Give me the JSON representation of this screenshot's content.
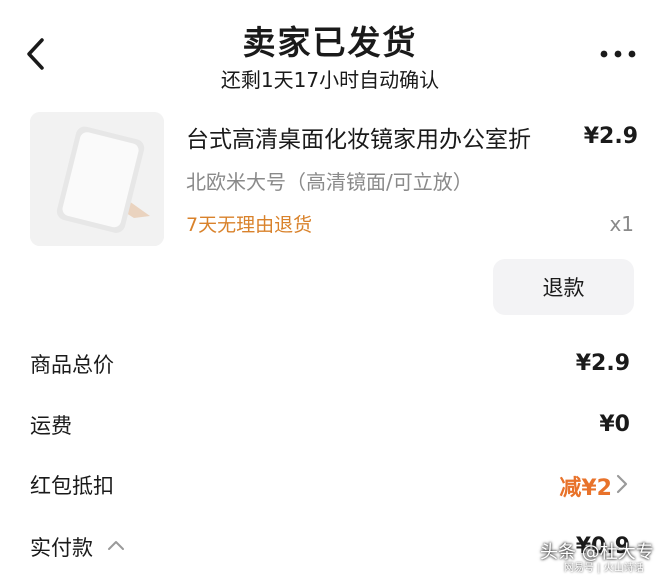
{
  "header": {
    "title": "卖家已发货",
    "subtitle": "还剩1天17小时自动确认"
  },
  "product": {
    "name": "台式高清桌面化妆镜家用办公室折",
    "price": "¥2.9",
    "variant": "北欧米大号（高清镜面/可立放）",
    "return_policy": "7天无理由退货",
    "quantity": "x1",
    "refund_label": "退款"
  },
  "summary": {
    "total_label": "商品总价",
    "total_value": "¥2.9",
    "shipping_label": "运费",
    "shipping_value": "¥0",
    "redpacket_label": "红包抵扣",
    "redpacket_value": "减¥2",
    "paid_label": "实付款",
    "paid_value": "¥0.9"
  },
  "watermark": {
    "line1": "头条 @杜大专",
    "line2": "网易号 | 火山诗话"
  },
  "colors": {
    "accent_orange": "#e8722a",
    "policy_orange": "#d9822b",
    "muted_text": "#8a8a8a"
  },
  "icons": [
    "back-icon",
    "more-icon",
    "chevron-right-icon",
    "chevron-up-icon"
  ]
}
